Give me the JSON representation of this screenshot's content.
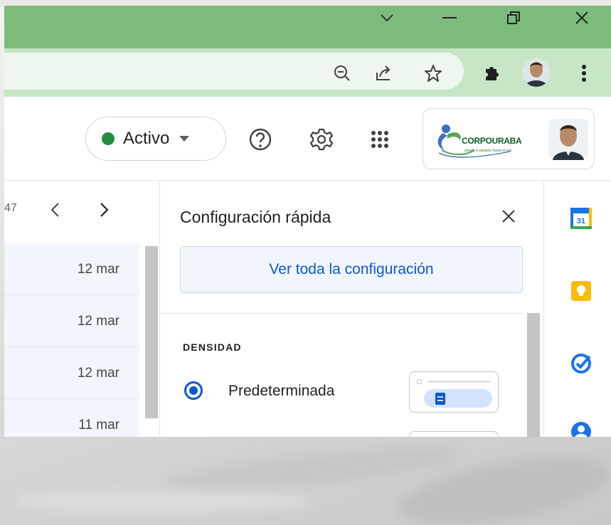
{
  "window": {
    "controls": [
      {
        "name": "tab-search-button",
        "icon": "chevron-down-icon"
      },
      {
        "name": "minimize-button",
        "icon": "minimize-icon"
      },
      {
        "name": "restore-button",
        "icon": "restore-icon"
      },
      {
        "name": "close-window-button",
        "icon": "close-icon"
      }
    ]
  },
  "toolbar": {
    "icons": [
      "zoom-out-icon",
      "share-icon",
      "bookmark-star-icon",
      "extensions-icon",
      "profile-avatar",
      "menu-dots-icon"
    ]
  },
  "header": {
    "status": {
      "label": "Activo",
      "color": "#1e8e3e"
    },
    "logo": {
      "text": "CORPOURABA",
      "tagline": "Desde el páramo hasta el mar"
    }
  },
  "list": {
    "pager_text": "47",
    "rows": [
      {
        "date": "12 mar"
      },
      {
        "date": "12 mar"
      },
      {
        "date": "12 mar"
      },
      {
        "date": "11 mar"
      }
    ]
  },
  "quick_settings": {
    "title": "Configuración rápida",
    "view_all_label": "Ver toda la configuración",
    "section_label": "DENSIDAD",
    "options": [
      {
        "label": "Predeterminada",
        "selected": true
      }
    ]
  },
  "side_panel": {
    "apps": [
      "calendar-icon",
      "keep-icon",
      "tasks-icon",
      "contacts-icon"
    ],
    "calendar_day": "31"
  },
  "colors": {
    "titlebar": "#7cbb7b",
    "toolbar": "#c7e6c6",
    "accent": "#0b57d0"
  }
}
